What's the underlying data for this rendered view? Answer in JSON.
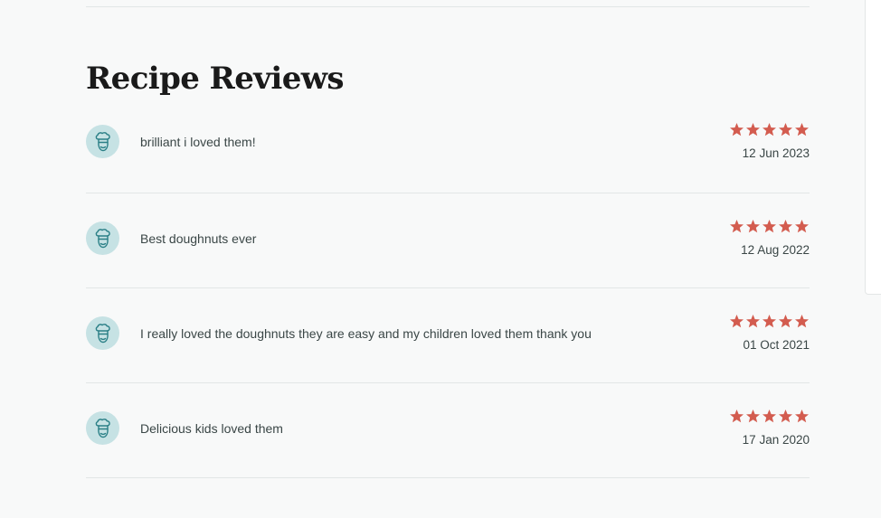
{
  "section": {
    "title": "Recipe Reviews"
  },
  "colors": {
    "star": "#d35c4f",
    "avatar_bg": "#c6e2e4",
    "avatar_icon": "#2a7f86"
  },
  "reviews": [
    {
      "text": "brilliant i loved them!",
      "date": "12 Jun 2023",
      "rating": 5,
      "avatar_icon": "chef-hat-icon"
    },
    {
      "text": "Best doughnuts ever",
      "date": "12 Aug 2022",
      "rating": 5,
      "avatar_icon": "chef-hat-icon"
    },
    {
      "text": "I really loved the doughnuts they are easy and my children loved them thank you",
      "date": "01 Oct 2021",
      "rating": 5,
      "avatar_icon": "chef-hat-icon"
    },
    {
      "text": "Delicious kids loved them",
      "date": "17 Jan 2020",
      "rating": 5,
      "avatar_icon": "chef-hat-icon"
    }
  ]
}
